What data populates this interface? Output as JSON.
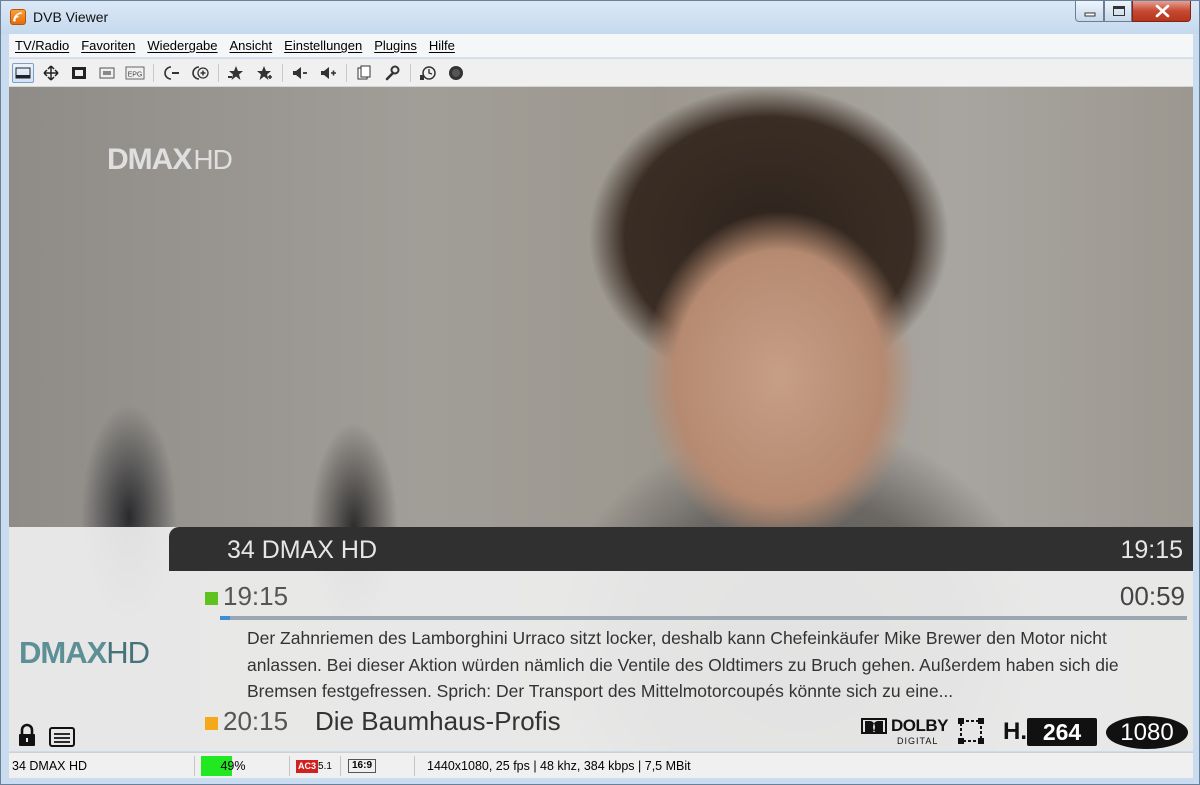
{
  "window": {
    "title": "DVB Viewer",
    "min_label": "",
    "max_label": "",
    "close_label": ""
  },
  "menu": [
    "TV/Radio",
    "Favoriten",
    "Wiedergabe",
    "Ansicht",
    "Einstellungen",
    "Plugins",
    "Hilfe"
  ],
  "toolbar": [
    {
      "icon": "window-mode-icon",
      "active": true
    },
    {
      "icon": "move-icon"
    },
    {
      "icon": "fullscreen-icon"
    },
    {
      "icon": "osd-icon"
    },
    {
      "icon": "epg-icon",
      "label": "EPG"
    },
    {
      "icon": "channel-minus-icon"
    },
    {
      "icon": "channel-plus-icon"
    },
    {
      "icon": "favorite-prev-icon"
    },
    {
      "icon": "favorite-next-icon"
    },
    {
      "icon": "volume-down-icon"
    },
    {
      "icon": "volume-up-icon"
    },
    {
      "icon": "copy-icon"
    },
    {
      "icon": "settings-wrench-icon"
    },
    {
      "icon": "timeshift-icon"
    },
    {
      "icon": "record-icon"
    }
  ],
  "video": {
    "channel_logo_top": "DMAX",
    "channel_logo_top_hd": "HD"
  },
  "osd": {
    "channel": "34 DMAX HD",
    "clock": "19:15",
    "current": {
      "start": "19:15",
      "remaining": "00:59",
      "progress_percent": 1,
      "description": "Der Zahnriemen des Lamborghini Urraco sitzt locker, deshalb kann Chefeinkäufer Mike Brewer den Motor nicht anlassen. Bei dieser Aktion würden nämlich die Ventile des Oldtimers zu Bruch gehen. Außerdem haben sich die Bremsen festgefressen. Sprich: Der Transport des Mittelmotorcoupés könnte sich zu eine..."
    },
    "next": {
      "start": "20:15",
      "title": "Die Baumhaus-Profis"
    },
    "channel_logo": "DMAX",
    "channel_logo_hd": "HD",
    "badges": {
      "dolby": "DOLBY",
      "dolby_sub": "DIGITAL",
      "codec_prefix": "H.",
      "codec": "264",
      "resolution": "1080"
    }
  },
  "status": {
    "channel": "34 DMAX HD",
    "signal_percent": 49,
    "signal_label": "49%",
    "audio_badge": "AC3",
    "audio_channels": "5.1",
    "aspect": "16:9",
    "stream_info": "1440x1080, 25 fps | 48 khz, 384 kbps | 7,5 MBit"
  },
  "colors": {
    "current_marker": "#5fc31f",
    "next_marker": "#f4a91a",
    "progress": "#3a8fd6",
    "signal": "#22e822"
  }
}
